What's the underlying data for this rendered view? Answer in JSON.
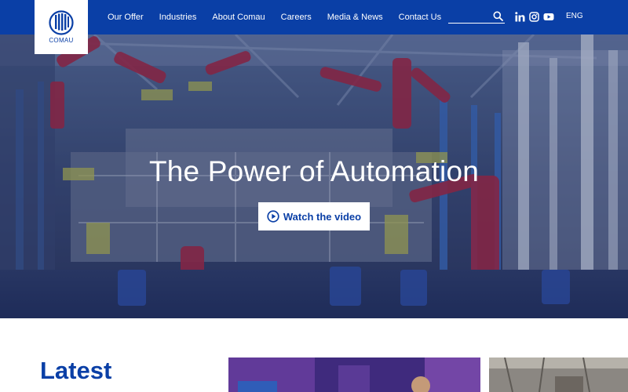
{
  "brand": {
    "name": "COMAU",
    "primary_color": "#0a3fa6"
  },
  "nav": {
    "items": [
      {
        "label": "Our Offer"
      },
      {
        "label": "Industries"
      },
      {
        "label": "About Comau"
      },
      {
        "label": "Careers"
      },
      {
        "label": "Media & News"
      },
      {
        "label": "Contact Us"
      }
    ]
  },
  "search": {
    "value": "",
    "icon": "search-icon"
  },
  "social": {
    "icons": [
      "linkedin-icon",
      "instagram-icon",
      "youtube-icon"
    ]
  },
  "language": {
    "label": "ENG"
  },
  "hero": {
    "title": "The Power of Automation",
    "cta_label": "Watch the video",
    "cta_icon": "play-circle-icon"
  },
  "latest": {
    "title": "Latest"
  }
}
